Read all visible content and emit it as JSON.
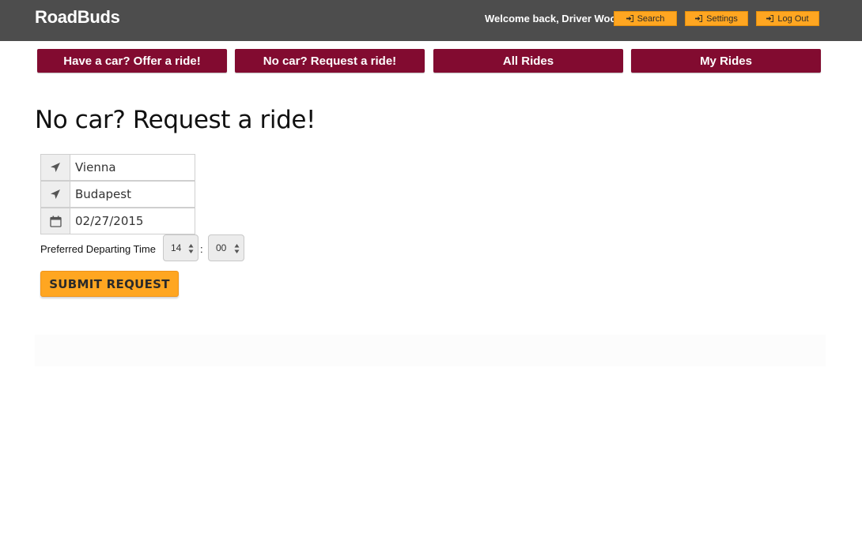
{
  "header": {
    "brand": "RoadBuds",
    "welcome": "Welcome back, Driver Woo!",
    "buttons": {
      "search": "Search",
      "settings": "Settings",
      "logout": "Log Out"
    },
    "icon": "sign-in-icon"
  },
  "nav": {
    "items": [
      {
        "label": "Have a car? Offer a ride!"
      },
      {
        "label": "No car? Request a ride!"
      },
      {
        "label": "All Rides"
      },
      {
        "label": "My Rides"
      }
    ]
  },
  "main": {
    "title": "No car? Request a ride!",
    "form": {
      "origin": {
        "value": "Vienna",
        "icon": "location-arrow-icon"
      },
      "destination": {
        "value": "Budapest",
        "icon": "location-arrow-icon"
      },
      "date": {
        "value": "02/27/2015",
        "icon": "calendar-icon"
      },
      "time_label": "Preferred Departing Time",
      "hour": "14",
      "separator": ":",
      "minute": "00",
      "submit": "SUBMIT REQUEST"
    }
  },
  "colors": {
    "header_bg": "#4d4d4d",
    "nav_bg": "#820b30",
    "accent": "#ffa621"
  }
}
